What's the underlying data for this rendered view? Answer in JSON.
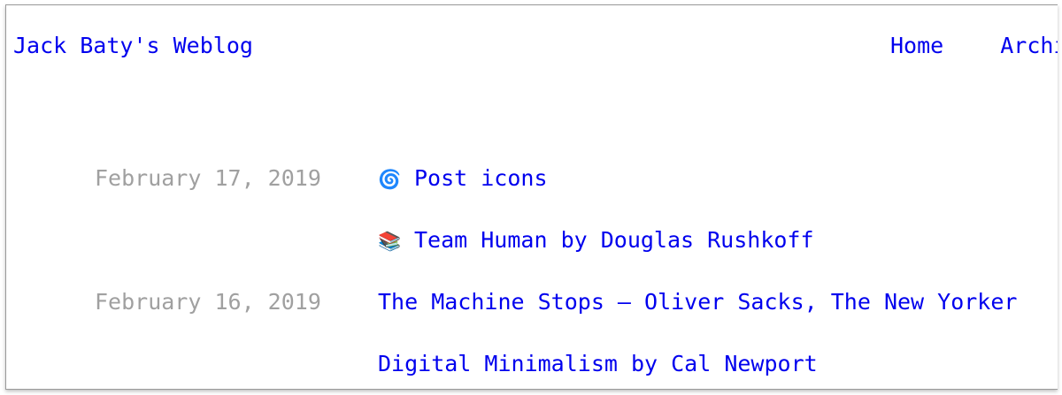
{
  "header": {
    "site_title": "Jack Baty's Weblog",
    "nav": [
      {
        "label": "Home"
      },
      {
        "label": "Archive"
      }
    ]
  },
  "posts": [
    {
      "date": "February 17, 2019",
      "icon": "cyclone-icon",
      "icon_glyph": "🌀",
      "title": "Post icons"
    },
    {
      "date": "",
      "icon": "books-icon",
      "icon_glyph": "📚",
      "title": "Team Human by Douglas Rushkoff"
    },
    {
      "date": "February 16, 2019",
      "icon": "",
      "icon_glyph": "",
      "title": "The Machine Stops – Oliver Sacks, The New Yorker"
    },
    {
      "date": "",
      "icon": "",
      "icon_glyph": "",
      "title": "Digital Minimalism by Cal Newport"
    }
  ],
  "colors": {
    "link": "#0000ee",
    "date": "#a0a0a0",
    "border": "#9a9a9a"
  }
}
